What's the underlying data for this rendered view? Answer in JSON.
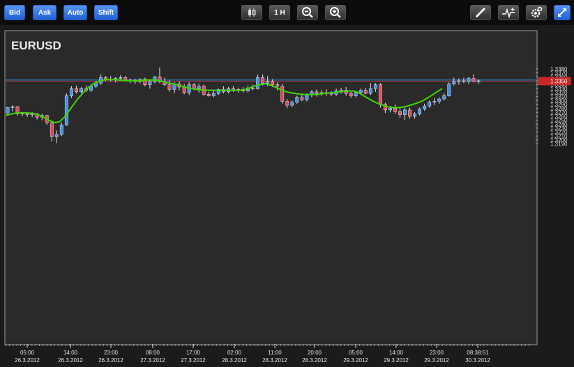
{
  "toolbar": {
    "bid_label": "Bid",
    "ask_label": "Ask",
    "auto_label": "Auto",
    "shift_label": "Shift",
    "timeframe_label": "1 H",
    "icons": [
      "candles-icon",
      "zoom-out-icon",
      "zoom-in-icon",
      "pencil-icon",
      "indicator-icon",
      "settings-icon",
      "expand-icon"
    ]
  },
  "colors": {
    "up": "#3d8fe6",
    "down": "#d94a55",
    "ma": "#3fd400",
    "bid_line": "#2a84d6",
    "ask_line": "#c63b3b",
    "price_tag": "#c62828",
    "plot_bg": "#2a2a2a"
  },
  "chart_data": {
    "type": "candlestick",
    "title": "EURUSD",
    "current_price_label": "1.3350",
    "ylim": [
      1.318,
      1.339
    ],
    "y_ticks": [
      "1.3380",
      "1.3370",
      "1.3360",
      "1.3350",
      "1.3340",
      "1.3330",
      "1.3320",
      "1.3310",
      "1.3300",
      "1.3290",
      "1.3280",
      "1.3270",
      "1.3260",
      "1.3250",
      "1.3240",
      "1.3230",
      "1.3220",
      "1.3210",
      "1.3200",
      "1.3190"
    ],
    "x_ticks": [
      {
        "time": "05:00",
        "date": "26.3.2012"
      },
      {
        "time": "14:00",
        "date": "26.3.2012"
      },
      {
        "time": "23:00",
        "date": "26.3.2012"
      },
      {
        "time": "08:00",
        "date": "27.3.2012"
      },
      {
        "time": "17:00",
        "date": "27.3.2012"
      },
      {
        "time": "02:00",
        "date": "28.3.2012"
      },
      {
        "time": "11:00",
        "date": "28.3.2012"
      },
      {
        "time": "20:00",
        "date": "28.3.2012"
      },
      {
        "time": "05:00",
        "date": "29.3.2012"
      },
      {
        "time": "14:00",
        "date": "29.3.2012"
      },
      {
        "time": "23:00",
        "date": "29.3.2012"
      },
      {
        "time": "08:38:51",
        "date": "30.3.2012"
      }
    ],
    "bid_level": 1.3352,
    "ask_level": 1.3349,
    "candles": [
      [
        1.3268,
        1.3284,
        1.3262,
        1.3282
      ],
      [
        1.3282,
        1.3288,
        1.3272,
        1.3284
      ],
      [
        1.3284,
        1.3286,
        1.3262,
        1.3266
      ],
      [
        1.3266,
        1.327,
        1.326,
        1.3268
      ],
      [
        1.3268,
        1.327,
        1.3258,
        1.3264
      ],
      [
        1.3264,
        1.327,
        1.3258,
        1.3266
      ],
      [
        1.3266,
        1.3268,
        1.3252,
        1.3258
      ],
      [
        1.3258,
        1.3266,
        1.325,
        1.3262
      ],
      [
        1.3262,
        1.3264,
        1.3238,
        1.3244
      ],
      [
        1.3244,
        1.3246,
        1.3196,
        1.3208
      ],
      [
        1.3208,
        1.3224,
        1.3192,
        1.3214
      ],
      [
        1.3214,
        1.3244,
        1.321,
        1.3238
      ],
      [
        1.3238,
        1.3318,
        1.3236,
        1.3312
      ],
      [
        1.3312,
        1.3336,
        1.3306,
        1.333
      ],
      [
        1.333,
        1.3338,
        1.3318,
        1.3322
      ],
      [
        1.3322,
        1.3334,
        1.3318,
        1.333
      ],
      [
        1.333,
        1.3338,
        1.3322,
        1.3326
      ],
      [
        1.3326,
        1.334,
        1.3322,
        1.3336
      ],
      [
        1.3336,
        1.335,
        1.3332,
        1.3344
      ],
      [
        1.3344,
        1.3366,
        1.334,
        1.3358
      ],
      [
        1.3358,
        1.3362,
        1.335,
        1.3354
      ],
      [
        1.3354,
        1.3362,
        1.3348,
        1.3352
      ],
      [
        1.3352,
        1.336,
        1.3346,
        1.3356
      ],
      [
        1.3356,
        1.3364,
        1.335,
        1.3358
      ],
      [
        1.3358,
        1.3362,
        1.3348,
        1.335
      ],
      [
        1.335,
        1.3356,
        1.3344,
        1.3352
      ],
      [
        1.3352,
        1.3354,
        1.3342,
        1.3348
      ],
      [
        1.3348,
        1.3356,
        1.3344,
        1.3354
      ],
      [
        1.3354,
        1.3358,
        1.3336,
        1.334
      ],
      [
        1.334,
        1.3352,
        1.333,
        1.3348
      ],
      [
        1.3348,
        1.3362,
        1.3344,
        1.336
      ],
      [
        1.336,
        1.3384,
        1.3344,
        1.3348
      ],
      [
        1.3348,
        1.3358,
        1.3336,
        1.334
      ],
      [
        1.334,
        1.3352,
        1.3322,
        1.3328
      ],
      [
        1.3328,
        1.3346,
        1.3318,
        1.3342
      ],
      [
        1.3342,
        1.3348,
        1.3326,
        1.3334
      ],
      [
        1.3334,
        1.3342,
        1.3316,
        1.332
      ],
      [
        1.332,
        1.3346,
        1.3314,
        1.334
      ],
      [
        1.334,
        1.3344,
        1.3326,
        1.333
      ],
      [
        1.333,
        1.3342,
        1.332,
        1.3336
      ],
      [
        1.3336,
        1.334,
        1.3312,
        1.3316
      ],
      [
        1.3316,
        1.3322,
        1.331,
        1.3312
      ],
      [
        1.3312,
        1.3324,
        1.3308,
        1.3318
      ],
      [
        1.3318,
        1.333,
        1.3314,
        1.3328
      ],
      [
        1.3328,
        1.3336,
        1.3318,
        1.3322
      ],
      [
        1.3322,
        1.3334,
        1.3318,
        1.333
      ],
      [
        1.333,
        1.3336,
        1.3322,
        1.3326
      ],
      [
        1.3326,
        1.3332,
        1.332,
        1.3328
      ],
      [
        1.3328,
        1.3334,
        1.332,
        1.3324
      ],
      [
        1.3324,
        1.3338,
        1.332,
        1.3332
      ],
      [
        1.3332,
        1.334,
        1.3326,
        1.333
      ],
      [
        1.333,
        1.3366,
        1.3328,
        1.3358
      ],
      [
        1.3358,
        1.3366,
        1.3338,
        1.3344
      ],
      [
        1.3344,
        1.3362,
        1.3336,
        1.3348
      ],
      [
        1.3348,
        1.3354,
        1.3334,
        1.334
      ],
      [
        1.334,
        1.3346,
        1.3326,
        1.3336
      ],
      [
        1.3336,
        1.3342,
        1.3292,
        1.3298
      ],
      [
        1.3298,
        1.3304,
        1.328,
        1.3288
      ],
      [
        1.3288,
        1.33,
        1.3284,
        1.3296
      ],
      [
        1.3296,
        1.3312,
        1.3292,
        1.3308
      ],
      [
        1.3308,
        1.3318,
        1.3298,
        1.3302
      ],
      [
        1.3302,
        1.3318,
        1.3298,
        1.3314
      ],
      [
        1.3314,
        1.3326,
        1.3308,
        1.3322
      ],
      [
        1.3322,
        1.3328,
        1.331,
        1.3318
      ],
      [
        1.3318,
        1.3326,
        1.3312,
        1.332
      ],
      [
        1.332,
        1.3328,
        1.3312,
        1.3318
      ],
      [
        1.3318,
        1.3324,
        1.3312,
        1.3316
      ],
      [
        1.3316,
        1.333,
        1.3312,
        1.3324
      ],
      [
        1.3324,
        1.3332,
        1.3318,
        1.3326
      ],
      [
        1.3326,
        1.3334,
        1.3312,
        1.3318
      ],
      [
        1.3318,
        1.3322,
        1.3306,
        1.3312
      ],
      [
        1.3312,
        1.3324,
        1.3308,
        1.332
      ],
      [
        1.332,
        1.333,
        1.3314,
        1.3326
      ],
      [
        1.3326,
        1.3332,
        1.3316,
        1.3318
      ],
      [
        1.3318,
        1.3344,
        1.3314,
        1.333
      ],
      [
        1.333,
        1.3344,
        1.3322,
        1.334
      ],
      [
        1.334,
        1.3344,
        1.3282,
        1.329
      ],
      [
        1.329,
        1.3294,
        1.3268,
        1.3276
      ],
      [
        1.3276,
        1.3286,
        1.327,
        1.328
      ],
      [
        1.328,
        1.329,
        1.3266,
        1.3272
      ],
      [
        1.3272,
        1.3284,
        1.3256,
        1.3264
      ],
      [
        1.3264,
        1.3282,
        1.325,
        1.3276
      ],
      [
        1.3276,
        1.3282,
        1.3254,
        1.326
      ],
      [
        1.326,
        1.327,
        1.3254,
        1.3266
      ],
      [
        1.3266,
        1.3282,
        1.3262,
        1.3278
      ],
      [
        1.3278,
        1.3292,
        1.3274,
        1.3286
      ],
      [
        1.3286,
        1.33,
        1.3282,
        1.3296
      ],
      [
        1.3296,
        1.3306,
        1.3288,
        1.3298
      ],
      [
        1.3298,
        1.3308,
        1.3292,
        1.3304
      ],
      [
        1.3304,
        1.3318,
        1.33,
        1.3312
      ],
      [
        1.3312,
        1.3346,
        1.331,
        1.3342
      ],
      [
        1.3342,
        1.3358,
        1.3338,
        1.3348
      ],
      [
        1.3348,
        1.3356,
        1.334,
        1.335
      ],
      [
        1.335,
        1.3358,
        1.3344,
        1.3348
      ],
      [
        1.3348,
        1.336,
        1.3342,
        1.3356
      ],
      [
        1.3356,
        1.3366,
        1.3346,
        1.3348
      ],
      [
        1.3348,
        1.3354,
        1.3342,
        1.335
      ]
    ],
    "ma_series": [
      1.3262,
      1.3265,
      1.3268,
      1.3269,
      1.3269,
      1.3268,
      1.3266,
      1.3262,
      1.3256,
      1.3249,
      1.3244,
      1.3246,
      1.3258,
      1.3275,
      1.3292,
      1.3308,
      1.3322,
      1.3334,
      1.3343,
      1.3349,
      1.3352,
      1.3353,
      1.3353,
      1.3352,
      1.3351,
      1.335,
      1.335,
      1.335,
      1.3351,
      1.3352,
      1.3352,
      1.3351,
      1.3348,
      1.3345,
      1.3343,
      1.334,
      1.3336,
      1.3333,
      1.333,
      1.3328,
      1.3327,
      1.3326,
      1.3326,
      1.3326,
      1.3326,
      1.3326,
      1.3326,
      1.3326,
      1.3326,
      1.3328,
      1.3333,
      1.3338,
      1.3341,
      1.3343,
      1.3339,
      1.3334,
      1.3328,
      1.3323,
      1.332,
      1.3318,
      1.3316,
      1.3315,
      1.3315,
      1.3315,
      1.3316,
      1.3318,
      1.3319,
      1.332,
      1.3322,
      1.3323,
      1.3324,
      1.3324,
      1.332,
      1.3312,
      1.3305,
      1.3298,
      1.3292,
      1.3288,
      1.3284,
      1.3282,
      1.3282,
      1.3283,
      1.3286,
      1.329,
      1.3294,
      1.3299,
      1.3306,
      1.3314,
      1.3322,
      1.333
    ]
  }
}
